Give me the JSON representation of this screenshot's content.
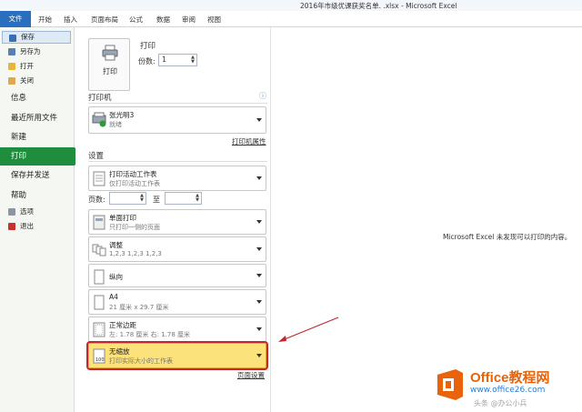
{
  "window": {
    "title": "2016年市级优课获奖名单. .xlsx - Microsoft Excel"
  },
  "ribbon_tabs": [
    "文件",
    "开始",
    "插入",
    "页面布局",
    "公式",
    "数据",
    "审阅",
    "视图"
  ],
  "nav": {
    "save": "保存",
    "save_as": "另存为",
    "open": "打开",
    "close": "关闭",
    "info": "信息",
    "recent": "最近所用文件",
    "new": "新建",
    "print": "打印",
    "save_send": "保存并发送",
    "help": "帮助",
    "options": "选项",
    "exit": "退出"
  },
  "print": {
    "section_title": "打印",
    "button_label": "打印",
    "copies_label": "份数:",
    "copies_value": "1"
  },
  "printer": {
    "section_title": "打印机",
    "name": "张光明3",
    "status": "就绪",
    "properties_link": "打印机属性"
  },
  "settings": {
    "section_title": "设置",
    "what": {
      "title": "打印活动工作表",
      "sub": "仅打印活动工作表"
    },
    "pages_label": "页数:",
    "to_label": "至",
    "sides": {
      "title": "单面打印",
      "sub": "只打印一侧的页面"
    },
    "collate": {
      "title": "调整",
      "sub": "1,2,3    1,2,3    1,2,3"
    },
    "orientation": {
      "title": "纵向"
    },
    "paper": {
      "title": "A4",
      "sub": "21 厘米 x 29.7 厘米"
    },
    "margins": {
      "title": "正常边距",
      "sub": "左: 1.78 厘米    右: 1.78 厘米"
    },
    "scaling": {
      "title": "无缩放",
      "sub": "打印实际大小的工作表"
    },
    "page_setup_link": "页面设置"
  },
  "preview": {
    "message": "Microsoft Excel 未发现可以打印的内容。"
  },
  "watermark": {
    "brand": "Office教程网",
    "url": "www.office26.com",
    "author": "头条 @办公小兵"
  },
  "colors": {
    "file_tab": "#2a6fbf",
    "nav_active": "#1e8e3e",
    "selected_option": "#fbe27a",
    "annotation": "#c3262f",
    "brand_orange": "#e9630a"
  }
}
